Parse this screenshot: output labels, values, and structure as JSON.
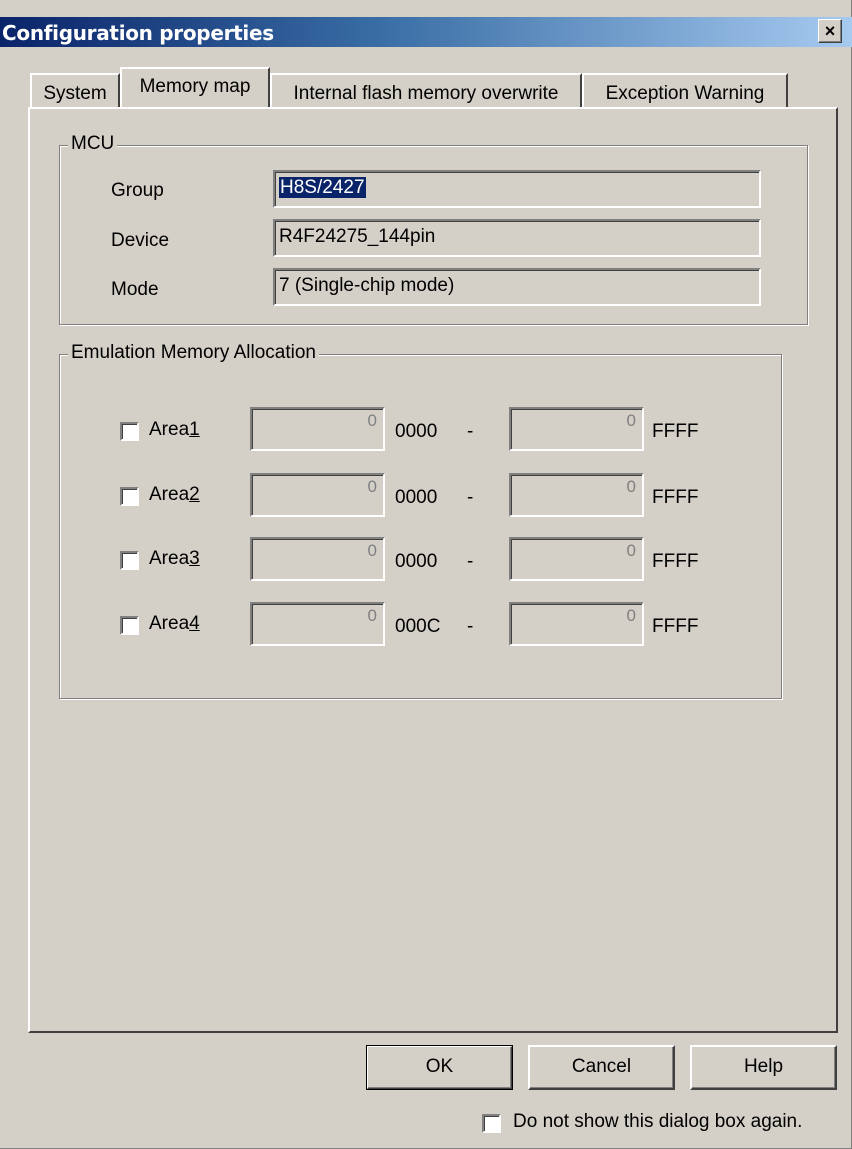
{
  "window": {
    "title": "Configuration properties",
    "close_glyph": "×"
  },
  "tabs": [
    {
      "label": "System",
      "active": false
    },
    {
      "label": "Memory map",
      "active": true
    },
    {
      "label": "Internal flash memory overwrite",
      "active": false
    },
    {
      "label": "Exception Warning",
      "active": false
    }
  ],
  "mcu": {
    "group_title": "MCU",
    "rows": [
      {
        "label": "Group",
        "value": "H8S/2427"
      },
      {
        "label": "Device",
        "value": "R4F24275_144pin"
      },
      {
        "label": "Mode",
        "value": "7 (Single-chip mode)"
      }
    ]
  },
  "emulation": {
    "group_title": "Emulation Memory Allocation",
    "areas": [
      {
        "label_prefix": "Area",
        "label_num": "1",
        "start_value": "0",
        "start_suffix": "0000",
        "dash": "-",
        "end_value": "0",
        "end_suffix": "FFFF",
        "checked": false
      },
      {
        "label_prefix": "Area",
        "label_num": "2",
        "start_value": "0",
        "start_suffix": "0000",
        "dash": "-",
        "end_value": "0",
        "end_suffix": "FFFF",
        "checked": false
      },
      {
        "label_prefix": "Area",
        "label_num": "3",
        "start_value": "0",
        "start_suffix": "0000",
        "dash": "-",
        "end_value": "0",
        "end_suffix": "FFFF",
        "checked": false
      },
      {
        "label_prefix": "Area",
        "label_num": "4",
        "start_value": "0",
        "start_suffix": "000C",
        "dash": "-",
        "end_value": "0",
        "end_suffix": "FFFF",
        "checked": false
      }
    ]
  },
  "buttons": {
    "ok": "OK",
    "cancel": "Cancel",
    "help": "Help"
  },
  "footer": {
    "dont_show_label": "Do not show this dialog box again.",
    "dont_show_checked": false
  }
}
